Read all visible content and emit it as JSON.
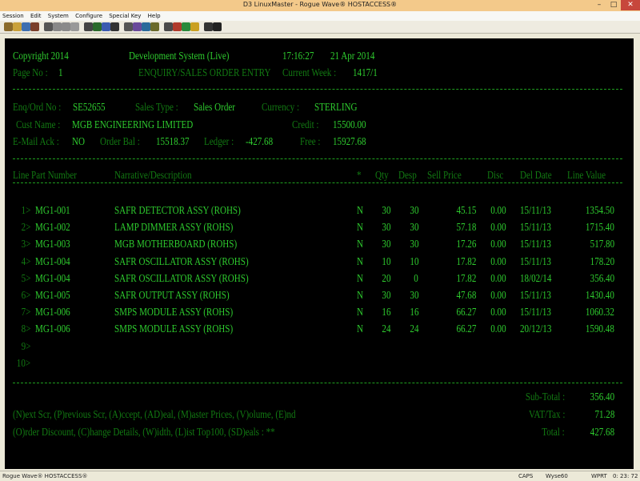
{
  "window": {
    "title": "D3 LinuxMaster - Rogue Wave® HOSTACCESS®",
    "min": "–",
    "max": "□",
    "close": "✕"
  },
  "menu": [
    "Session",
    "Edit",
    "System",
    "Configure",
    "Special Key",
    "Help"
  ],
  "toolbar_icons": [
    "new-session-icon",
    "open-icon",
    "save-icon",
    "close-session-icon",
    "print-icon",
    "copy-icon",
    "paste-icon",
    "cut-icon",
    "find-icon",
    "macro-record-icon",
    "macro-play-icon",
    "keyboard-icon",
    "font-icon",
    "color-icon",
    "display-icon",
    "ftp-icon",
    "settings-icon",
    "disconnect-icon",
    "reconnect-icon",
    "key-icon",
    "tools-icon",
    "help-icon"
  ],
  "screen": {
    "copyright": "Copyright 2014",
    "system": "Development System (Live)",
    "time": "17:16:27",
    "date": "21 Apr 2014",
    "page_label": "Page No :",
    "page_no": "1",
    "screen_title": "ENQUIRY/SALES ORDER ENTRY",
    "week_label": "Current Week :",
    "week": "1417/1",
    "enq_label": "Enq/Ord No :",
    "enq_no": "SE52655",
    "sales_type_label": "Sales Type :",
    "sales_type": "Sales Order",
    "currency_label": "Currency :",
    "currency": "STERLING",
    "cust_label": "Cust Name :",
    "cust_name": "MGB ENGINEERING LIMITED",
    "credit_label": "Credit :",
    "credit": "15500.00",
    "email_label": "E-Mail Ack :",
    "email_ack": "NO",
    "order_bal_label": "Order Bal :",
    "order_bal": "15518.37",
    "ledger_label": "Ledger :",
    "ledger": "-427.68",
    "free_label": "Free :",
    "free": "15927.68",
    "headers": {
      "line_part": "Line Part Number",
      "narrative": "Narrative/Description",
      "star": "*",
      "qty": "Qty",
      "desp": "Desp",
      "sell_price": "Sell Price",
      "disc": "Disc",
      "del_date": "Del Date",
      "line_value": "Line Value"
    },
    "lines": [
      {
        "no": "1>",
        "part": "MG1-001",
        "desc": "SAFR DETECTOR ASSY (ROHS)",
        "flag": "N",
        "qty": "30",
        "desp": "30",
        "price": "45.15",
        "disc": "0.00",
        "date": "15/11/13",
        "value": "1354.50"
      },
      {
        "no": "2>",
        "part": "MG1-002",
        "desc": "LAMP DIMMER ASSY (ROHS)",
        "flag": "N",
        "qty": "30",
        "desp": "30",
        "price": "57.18",
        "disc": "0.00",
        "date": "15/11/13",
        "value": "1715.40"
      },
      {
        "no": "3>",
        "part": "MG1-003",
        "desc": "MGB MOTHERBOARD (ROHS)",
        "flag": "N",
        "qty": "30",
        "desp": "30",
        "price": "17.26",
        "disc": "0.00",
        "date": "15/11/13",
        "value": "517.80"
      },
      {
        "no": "4>",
        "part": "MG1-004",
        "desc": "SAFR OSCILLATOR ASSY (ROHS)",
        "flag": "N",
        "qty": "10",
        "desp": "10",
        "price": "17.82",
        "disc": "0.00",
        "date": "15/11/13",
        "value": "178.20"
      },
      {
        "no": "5>",
        "part": "MG1-004",
        "desc": "SAFR OSCILLATOR ASSY (ROHS)",
        "flag": "N",
        "qty": "20",
        "desp": "0",
        "price": "17.82",
        "disc": "0.00",
        "date": "18/02/14",
        "value": "356.40"
      },
      {
        "no": "6>",
        "part": "MG1-005",
        "desc": "SAFR OUTPUT ASSY (ROHS)",
        "flag": "N",
        "qty": "30",
        "desp": "30",
        "price": "47.68",
        "disc": "0.00",
        "date": "15/11/13",
        "value": "1430.40"
      },
      {
        "no": "7>",
        "part": "MG1-006",
        "desc": "SMPS MODULE ASSY (ROHS)",
        "flag": "N",
        "qty": "16",
        "desp": "16",
        "price": "66.27",
        "disc": "0.00",
        "date": "15/11/13",
        "value": "1060.32"
      },
      {
        "no": "8>",
        "part": "MG1-006",
        "desc": "SMPS MODULE ASSY (ROHS)",
        "flag": "N",
        "qty": "24",
        "desp": "24",
        "price": "66.27",
        "disc": "0.00",
        "date": "20/12/13",
        "value": "1590.48"
      },
      {
        "no": "9>",
        "part": "",
        "desc": "",
        "flag": "",
        "qty": "",
        "desp": "",
        "price": "",
        "disc": "",
        "date": "",
        "value": ""
      },
      {
        "no": "10>",
        "part": "",
        "desc": "",
        "flag": "",
        "qty": "",
        "desp": "",
        "price": "",
        "disc": "",
        "date": "",
        "value": ""
      }
    ],
    "subtotal_label": "Sub-Total :",
    "subtotal": "356.40",
    "vat_label": "VAT/Tax :",
    "vat": "71.28",
    "total_label": "Total :",
    "total": "427.68",
    "commands_line1": "(N)ext Scr, (P)revious Scr, (A)ccept, (AD)eal, (M)aster Prices, (V)olume, (E)nd",
    "commands_line2": "(O)rder Discount, (C)hange Details, (W)idth, (L)ist Top100, (SD)eals : **"
  },
  "status": {
    "app": "Rogue Wave® HOSTACCESS®",
    "caps": "CAPS",
    "emulation": "Wyse60",
    "mode": "WPRT",
    "cursor": "0: 23: 72"
  }
}
